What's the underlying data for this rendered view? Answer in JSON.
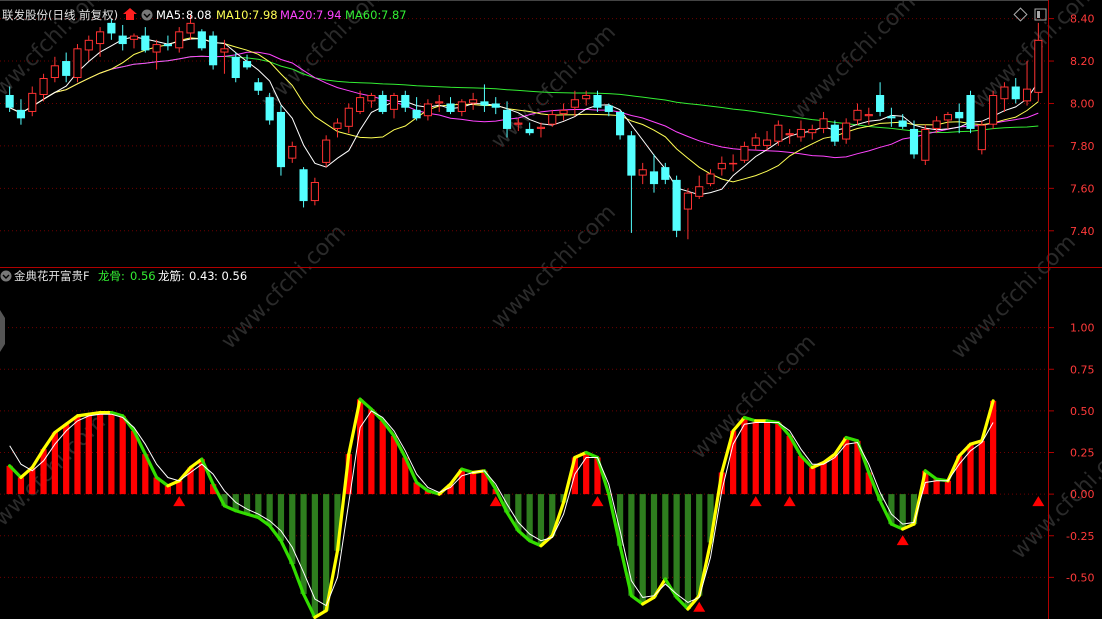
{
  "colors": {
    "up": "#ff3232",
    "down": "#54ffff",
    "axis": "#b00000",
    "grid": "#6e0000",
    "ma5": "#ffffff",
    "ma10": "#ffff55",
    "ma20": "#ff44ff",
    "ma60": "#33ee33",
    "bull_bar": "#ff0000",
    "bear_bar": "#2e7d1e",
    "line_up": "#ffff00",
    "line_down": "#33dd00",
    "signal": "#ff0000",
    "watermark": "#2a2a2a"
  },
  "header": {
    "title": "联发股份(日线 前复权)",
    "ma5_label": "MA5:",
    "ma5_value": "8.08",
    "ma10_label": "MA10:",
    "ma10_value": "7.98",
    "ma20_label": "MA20:",
    "ma20_value": "7.94",
    "ma60_label": "MA60:",
    "ma60_value": "7.87"
  },
  "indicator_header": {
    "title": "金典花开富贵F",
    "bone_label": "龙骨:",
    "bone_value": "0.56",
    "tendon_label": "龙筋:",
    "tendon_value": "0.43",
    "extra_value": ": 0.56"
  },
  "watermark": "www.cfchi.com",
  "chart_data": [
    {
      "type": "candlestick",
      "ylim": [
        7.3,
        8.45
      ],
      "yticks": [
        "8.40",
        "8.20",
        "8.00",
        "7.80",
        "7.60",
        "7.40"
      ],
      "candles": [
        {
          "o": 8.04,
          "h": 8.08,
          "l": 7.96,
          "c": 7.98
        },
        {
          "o": 7.97,
          "h": 8.02,
          "l": 7.9,
          "c": 7.93
        },
        {
          "o": 7.96,
          "h": 8.08,
          "l": 7.94,
          "c": 8.05
        },
        {
          "o": 8.04,
          "h": 8.14,
          "l": 8.01,
          "c": 8.12
        },
        {
          "o": 8.12,
          "h": 8.22,
          "l": 8.1,
          "c": 8.18
        },
        {
          "o": 8.2,
          "h": 8.24,
          "l": 8.1,
          "c": 8.13
        },
        {
          "o": 8.12,
          "h": 8.28,
          "l": 8.1,
          "c": 8.26
        },
        {
          "o": 8.25,
          "h": 8.32,
          "l": 8.2,
          "c": 8.3
        },
        {
          "o": 8.28,
          "h": 8.36,
          "l": 8.22,
          "c": 8.34
        },
        {
          "o": 8.38,
          "h": 8.4,
          "l": 8.3,
          "c": 8.33
        },
        {
          "o": 8.32,
          "h": 8.37,
          "l": 8.25,
          "c": 8.28
        },
        {
          "o": 8.3,
          "h": 8.33,
          "l": 8.26,
          "c": 8.32
        },
        {
          "o": 8.32,
          "h": 8.36,
          "l": 8.24,
          "c": 8.25
        },
        {
          "o": 8.24,
          "h": 8.3,
          "l": 8.16,
          "c": 8.28
        },
        {
          "o": 8.28,
          "h": 8.32,
          "l": 8.25,
          "c": 8.27
        },
        {
          "o": 8.26,
          "h": 8.36,
          "l": 8.24,
          "c": 8.34
        },
        {
          "o": 8.33,
          "h": 8.42,
          "l": 8.3,
          "c": 8.38
        },
        {
          "o": 8.34,
          "h": 8.35,
          "l": 8.25,
          "c": 8.26
        },
        {
          "o": 8.32,
          "h": 8.34,
          "l": 8.16,
          "c": 8.18
        },
        {
          "o": 8.24,
          "h": 8.3,
          "l": 8.14,
          "c": 8.26
        },
        {
          "o": 8.22,
          "h": 8.24,
          "l": 8.1,
          "c": 8.12
        },
        {
          "o": 8.2,
          "h": 8.23,
          "l": 8.16,
          "c": 8.17
        },
        {
          "o": 8.1,
          "h": 8.12,
          "l": 8.04,
          "c": 8.06
        },
        {
          "o": 8.03,
          "h": 8.05,
          "l": 7.9,
          "c": 7.92
        },
        {
          "o": 7.96,
          "h": 7.99,
          "l": 7.66,
          "c": 7.7
        },
        {
          "o": 7.74,
          "h": 7.82,
          "l": 7.72,
          "c": 7.8
        },
        {
          "o": 7.69,
          "h": 7.7,
          "l": 7.51,
          "c": 7.54
        },
        {
          "o": 7.54,
          "h": 7.65,
          "l": 7.52,
          "c": 7.63
        },
        {
          "o": 7.72,
          "h": 7.85,
          "l": 7.7,
          "c": 7.83
        },
        {
          "o": 7.88,
          "h": 7.93,
          "l": 7.84,
          "c": 7.91
        },
        {
          "o": 7.89,
          "h": 8.0,
          "l": 7.86,
          "c": 7.98
        },
        {
          "o": 7.96,
          "h": 8.06,
          "l": 7.95,
          "c": 8.03
        },
        {
          "o": 8.01,
          "h": 8.05,
          "l": 7.98,
          "c": 8.04
        },
        {
          "o": 8.04,
          "h": 8.06,
          "l": 7.95,
          "c": 7.96
        },
        {
          "o": 7.97,
          "h": 8.05,
          "l": 7.93,
          "c": 8.04
        },
        {
          "o": 8.04,
          "h": 8.06,
          "l": 7.96,
          "c": 7.98
        },
        {
          "o": 7.97,
          "h": 8.03,
          "l": 7.92,
          "c": 7.93
        },
        {
          "o": 7.94,
          "h": 8.02,
          "l": 7.92,
          "c": 8.0
        },
        {
          "o": 8.0,
          "h": 8.04,
          "l": 7.96,
          "c": 8.01
        },
        {
          "o": 8.0,
          "h": 8.03,
          "l": 7.95,
          "c": 7.96
        },
        {
          "o": 7.96,
          "h": 8.02,
          "l": 7.94,
          "c": 8.01
        },
        {
          "o": 8.0,
          "h": 8.05,
          "l": 7.97,
          "c": 8.02
        },
        {
          "o": 8.01,
          "h": 8.09,
          "l": 7.96,
          "c": 7.99
        },
        {
          "o": 8.0,
          "h": 8.03,
          "l": 7.95,
          "c": 7.98
        },
        {
          "o": 7.97,
          "h": 8.01,
          "l": 7.84,
          "c": 7.88
        },
        {
          "o": 7.9,
          "h": 7.93,
          "l": 7.87,
          "c": 7.91
        },
        {
          "o": 7.88,
          "h": 7.91,
          "l": 7.85,
          "c": 7.86
        },
        {
          "o": 7.88,
          "h": 7.91,
          "l": 7.84,
          "c": 7.89
        },
        {
          "o": 7.9,
          "h": 7.97,
          "l": 7.89,
          "c": 7.95
        },
        {
          "o": 7.95,
          "h": 8.0,
          "l": 7.92,
          "c": 7.97
        },
        {
          "o": 7.98,
          "h": 8.06,
          "l": 7.94,
          "c": 8.02
        },
        {
          "o": 8.02,
          "h": 8.06,
          "l": 7.99,
          "c": 8.04
        },
        {
          "o": 8.04,
          "h": 8.06,
          "l": 7.96,
          "c": 7.98
        },
        {
          "o": 7.99,
          "h": 8.0,
          "l": 7.94,
          "c": 7.96
        },
        {
          "o": 7.96,
          "h": 7.97,
          "l": 7.83,
          "c": 7.85
        },
        {
          "o": 7.85,
          "h": 7.87,
          "l": 7.39,
          "c": 7.66
        },
        {
          "o": 7.66,
          "h": 7.72,
          "l": 7.62,
          "c": 7.69
        },
        {
          "o": 7.68,
          "h": 7.76,
          "l": 7.58,
          "c": 7.62
        },
        {
          "o": 7.7,
          "h": 7.72,
          "l": 7.62,
          "c": 7.64
        },
        {
          "o": 7.64,
          "h": 7.66,
          "l": 7.37,
          "c": 7.4
        },
        {
          "o": 7.5,
          "h": 7.6,
          "l": 7.36,
          "c": 7.58
        },
        {
          "o": 7.56,
          "h": 7.66,
          "l": 7.55,
          "c": 7.61
        },
        {
          "o": 7.62,
          "h": 7.69,
          "l": 7.61,
          "c": 7.67
        },
        {
          "o": 7.69,
          "h": 7.75,
          "l": 7.66,
          "c": 7.72
        },
        {
          "o": 7.72,
          "h": 7.76,
          "l": 7.68,
          "c": 7.72
        },
        {
          "o": 7.73,
          "h": 7.82,
          "l": 7.72,
          "c": 7.8
        },
        {
          "o": 7.8,
          "h": 7.86,
          "l": 7.78,
          "c": 7.84
        },
        {
          "o": 7.8,
          "h": 7.87,
          "l": 7.78,
          "c": 7.83
        },
        {
          "o": 7.82,
          "h": 7.92,
          "l": 7.8,
          "c": 7.9
        },
        {
          "o": 7.85,
          "h": 7.88,
          "l": 7.81,
          "c": 7.86
        },
        {
          "o": 7.84,
          "h": 7.92,
          "l": 7.82,
          "c": 7.88
        },
        {
          "o": 7.86,
          "h": 7.9,
          "l": 7.83,
          "c": 7.88
        },
        {
          "o": 7.88,
          "h": 7.96,
          "l": 7.86,
          "c": 7.93
        },
        {
          "o": 7.9,
          "h": 7.92,
          "l": 7.8,
          "c": 7.82
        },
        {
          "o": 7.83,
          "h": 7.93,
          "l": 7.81,
          "c": 7.91
        },
        {
          "o": 7.92,
          "h": 8.0,
          "l": 7.9,
          "c": 7.97
        },
        {
          "o": 7.94,
          "h": 7.98,
          "l": 7.9,
          "c": 7.95
        },
        {
          "o": 8.04,
          "h": 8.1,
          "l": 7.94,
          "c": 7.96
        },
        {
          "o": 7.94,
          "h": 7.98,
          "l": 7.89,
          "c": 7.93
        },
        {
          "o": 7.92,
          "h": 7.95,
          "l": 7.88,
          "c": 7.89
        },
        {
          "o": 7.88,
          "h": 7.92,
          "l": 7.74,
          "c": 7.76
        },
        {
          "o": 7.73,
          "h": 7.9,
          "l": 7.71,
          "c": 7.88
        },
        {
          "o": 7.88,
          "h": 7.94,
          "l": 7.86,
          "c": 7.92
        },
        {
          "o": 7.92,
          "h": 7.96,
          "l": 7.88,
          "c": 7.95
        },
        {
          "o": 7.96,
          "h": 8.0,
          "l": 7.86,
          "c": 7.93
        },
        {
          "o": 8.04,
          "h": 8.06,
          "l": 7.86,
          "c": 7.88
        },
        {
          "o": 7.78,
          "h": 7.92,
          "l": 7.76,
          "c": 7.9
        },
        {
          "o": 7.9,
          "h": 8.06,
          "l": 7.88,
          "c": 8.04
        },
        {
          "o": 8.02,
          "h": 8.1,
          "l": 7.96,
          "c": 8.08
        },
        {
          "o": 8.08,
          "h": 8.12,
          "l": 8.0,
          "c": 8.02
        },
        {
          "o": 8.01,
          "h": 8.2,
          "l": 7.99,
          "c": 8.07
        },
        {
          "o": 8.05,
          "h": 8.38,
          "l": 8.01,
          "c": 8.3
        }
      ]
    },
    {
      "type": "bar",
      "ylim": [
        -0.75,
        1.25
      ],
      "yticks": [
        "1.00",
        "0.75",
        "0.50",
        "0.25",
        "0.00",
        "-0.25",
        "-0.50"
      ],
      "bone_values": [
        0.17,
        0.1,
        0.16,
        0.27,
        0.37,
        0.42,
        0.47,
        0.48,
        0.49,
        0.49,
        0.47,
        0.38,
        0.24,
        0.1,
        0.05,
        0.08,
        0.16,
        0.21,
        0.06,
        -0.07,
        -0.1,
        -0.12,
        -0.14,
        -0.19,
        -0.28,
        -0.42,
        -0.6,
        -0.74,
        -0.7,
        -0.34,
        0.24,
        0.57,
        0.51,
        0.44,
        0.35,
        0.22,
        0.07,
        0.02,
        0.0,
        0.06,
        0.15,
        0.13,
        0.14,
        0.03,
        -0.11,
        -0.22,
        -0.28,
        -0.31,
        -0.25,
        -0.05,
        0.22,
        0.25,
        0.22,
        0.0,
        -0.31,
        -0.61,
        -0.66,
        -0.62,
        -0.51,
        -0.62,
        -0.69,
        -0.61,
        -0.29,
        0.13,
        0.38,
        0.46,
        0.44,
        0.44,
        0.43,
        0.35,
        0.23,
        0.16,
        0.19,
        0.24,
        0.34,
        0.32,
        0.13,
        -0.04,
        -0.18,
        -0.21,
        -0.18,
        0.14,
        0.09,
        0.08,
        0.23,
        0.3,
        0.32,
        0.56
      ],
      "tendon_values": [
        0.29,
        0.18,
        0.14,
        0.2,
        0.3,
        0.38,
        0.44,
        0.47,
        0.48,
        0.48,
        0.46,
        0.4,
        0.3,
        0.18,
        0.1,
        0.08,
        0.13,
        0.18,
        0.12,
        0.02,
        -0.05,
        -0.09,
        -0.12,
        -0.16,
        -0.22,
        -0.32,
        -0.47,
        -0.63,
        -0.67,
        -0.5,
        -0.05,
        0.4,
        0.5,
        0.46,
        0.38,
        0.26,
        0.12,
        0.04,
        0.01,
        0.04,
        0.11,
        0.13,
        0.14,
        0.06,
        -0.06,
        -0.17,
        -0.24,
        -0.28,
        -0.26,
        -0.12,
        0.12,
        0.22,
        0.22,
        0.06,
        -0.22,
        -0.52,
        -0.62,
        -0.61,
        -0.54,
        -0.6,
        -0.65,
        -0.62,
        -0.38,
        0.02,
        0.3,
        0.42,
        0.43,
        0.43,
        0.43,
        0.38,
        0.27,
        0.18,
        0.18,
        0.22,
        0.3,
        0.31,
        0.18,
        0.01,
        -0.12,
        -0.18,
        -0.17,
        0.07,
        0.08,
        0.08,
        0.18,
        0.26,
        0.31,
        0.43
      ],
      "signals": [
        15,
        43,
        52,
        61,
        66,
        69,
        79,
        91
      ]
    }
  ]
}
